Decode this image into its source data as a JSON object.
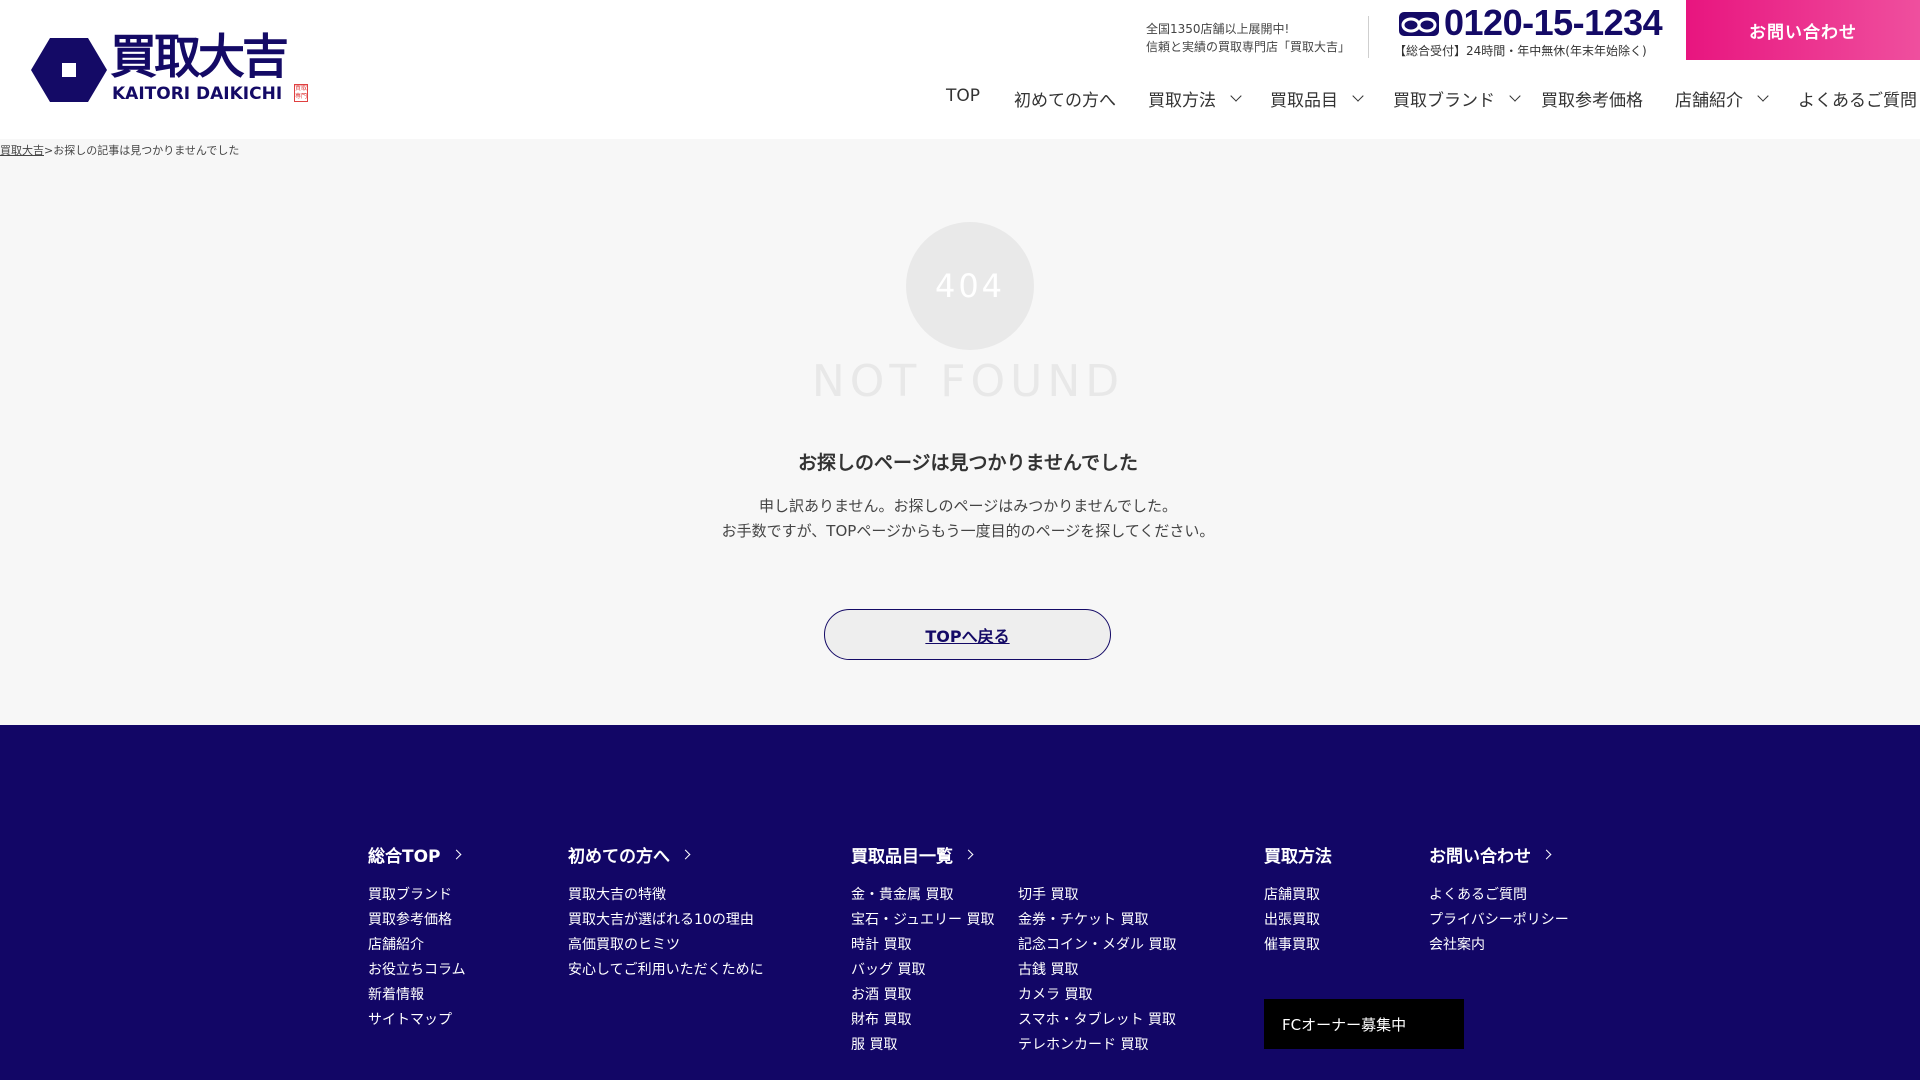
{
  "brand": {
    "name_jp": "買取大吉",
    "name_en": "KAITORI DAIKICHI",
    "seal": "買取専門",
    "colors": {
      "navy": "#140a66",
      "pink": "#e8157f",
      "footer": "#120666"
    }
  },
  "header": {
    "tagline_1": "全国1350店舗以上展開中!",
    "tagline_2": "信頼と実績の買取専門店「買取大吉」",
    "phone_icon": "free-dial-icon",
    "phone_number": "0120-15-1234",
    "phone_hours": "【総合受付】24時間・年中無休(年末年始除く)",
    "contact_label": "お問い合わせ"
  },
  "nav": [
    {
      "label": "TOP"
    },
    {
      "label": "初めての方へ"
    },
    {
      "label": "買取方法"
    },
    {
      "label": "買取品目"
    },
    {
      "label": "買取ブランド"
    },
    {
      "label": "買取参考価格"
    },
    {
      "label": "店舗紹介"
    },
    {
      "label": "よくあるご質問"
    }
  ],
  "breadcrumb": {
    "home": "買取大吉",
    "current": ">お探しの記事は見つかりませんでした"
  },
  "error": {
    "code": "404",
    "headline": "NOT FOUND",
    "title": "お探しのページは見つかりませんでした",
    "body_1": "申し訳ありません。お探しのページはみつかりませんでした。",
    "body_2": "お手数ですが、TOPページからもう一度目的のページを探してください。",
    "button": "TOPへ戻る"
  },
  "footer": {
    "col1": {
      "head": "総合TOP",
      "links": [
        "買取ブランド",
        "買取参考価格",
        "店舗紹介",
        "お役立ちコラム",
        "新着情報",
        "サイトマップ"
      ]
    },
    "col2": {
      "head": "初めての方へ",
      "links": [
        "買取大吉の特徴",
        "買取大吉が選ばれる10の理由",
        "高価買取のヒミツ",
        "安心してご利用いただくために"
      ]
    },
    "col3": {
      "head": "買取品目一覧",
      "links_a": [
        "金・貴金属 買取",
        "宝石・ジュエリー 買取",
        "時計 買取",
        "バッグ 買取",
        "お酒 買取",
        "財布 買取",
        "服 買取"
      ],
      "links_b": [
        "切手 買取",
        "金券・チケット 買取",
        "記念コイン・メダル 買取",
        "古銭 買取",
        "カメラ 買取",
        "スマホ・タブレット 買取",
        "テレホンカード 買取"
      ]
    },
    "col4": {
      "head": "買取方法",
      "links": [
        "店舗買取",
        "出張買取",
        "催事買取"
      ]
    },
    "col5": {
      "head": "お問い合わせ",
      "links": [
        "よくあるご質問",
        "プライバシーポリシー",
        "会社案内"
      ]
    },
    "fc_button": "FCオーナー募集中"
  }
}
